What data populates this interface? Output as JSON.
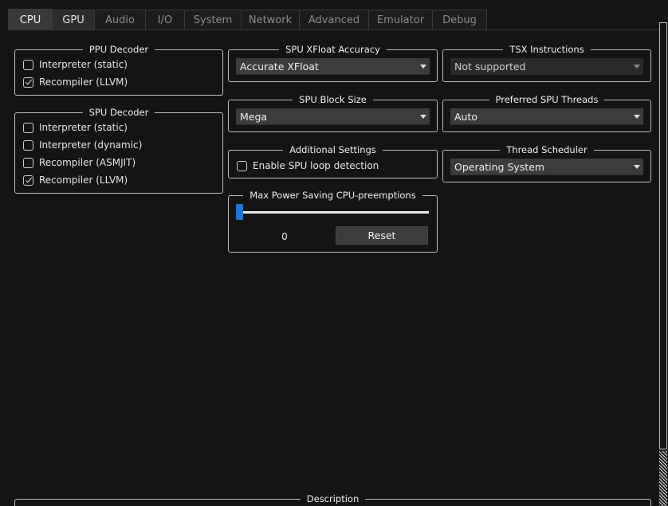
{
  "tabs": [
    "CPU",
    "GPU",
    "Audio",
    "I/O",
    "System",
    "Network",
    "Advanced",
    "Emulator",
    "Debug"
  ],
  "ppu_decoder": {
    "title": "PPU Decoder",
    "options": [
      {
        "label": "Interpreter (static)",
        "checked": false
      },
      {
        "label": "Recompiler (LLVM)",
        "checked": true
      }
    ]
  },
  "spu_decoder": {
    "title": "SPU Decoder",
    "options": [
      {
        "label": "Interpreter (static)",
        "checked": false
      },
      {
        "label": "Interpreter (dynamic)",
        "checked": false
      },
      {
        "label": "Recompiler (ASMJIT)",
        "checked": false
      },
      {
        "label": "Recompiler (LLVM)",
        "checked": true
      }
    ]
  },
  "spu_xfloat": {
    "title": "SPU XFloat Accuracy",
    "value": "Accurate XFloat"
  },
  "tsx": {
    "title": "TSX Instructions",
    "value": "Not supported"
  },
  "spu_block": {
    "title": "SPU Block Size",
    "value": "Mega"
  },
  "spu_threads": {
    "title": "Preferred SPU Threads",
    "value": "Auto"
  },
  "additional": {
    "title": "Additional Settings",
    "loop_label": "Enable SPU loop detection",
    "loop_checked": false
  },
  "scheduler": {
    "title": "Thread Scheduler",
    "value": "Operating System"
  },
  "power": {
    "title": "Max Power Saving CPU-preemptions",
    "value": "0",
    "reset_label": "Reset",
    "level": 0
  },
  "description": {
    "title": "Description"
  }
}
